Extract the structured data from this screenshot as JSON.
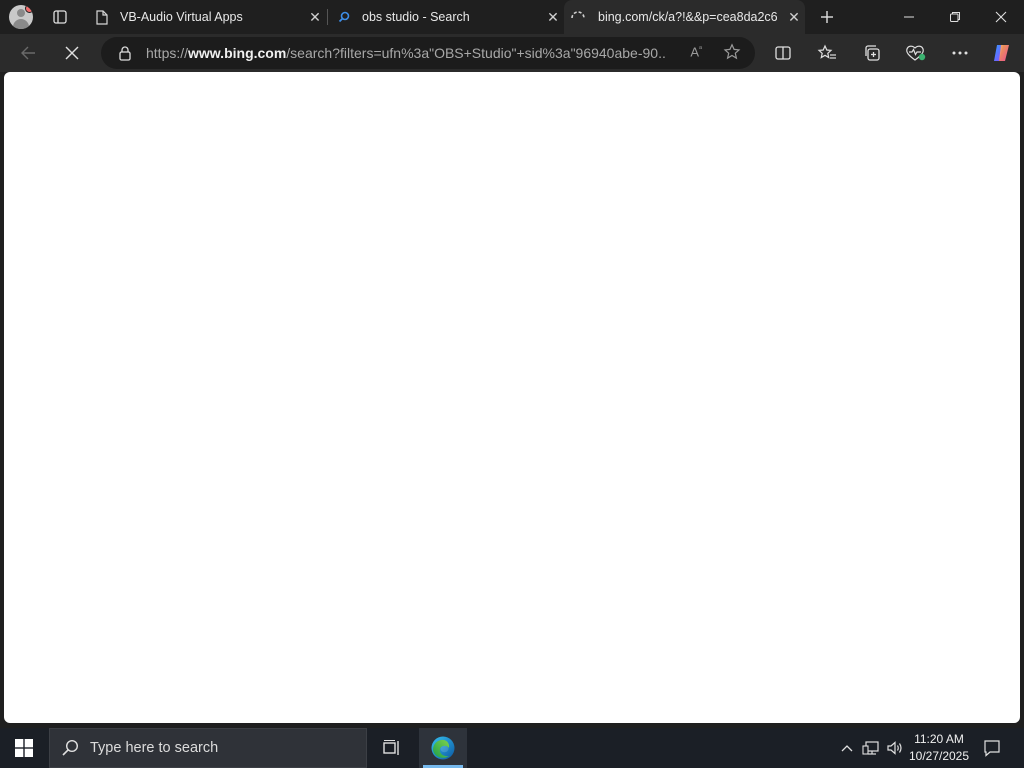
{
  "tabs": [
    {
      "label": "VB-Audio Virtual Apps",
      "icon": "page-icon"
    },
    {
      "label": "obs studio - Search",
      "icon": "search-icon"
    },
    {
      "label": "bing.com/ck/a?!&&p=cea8da2c6",
      "icon": "loading-spinner-icon",
      "active": true
    }
  ],
  "address": {
    "url_prefix": "https://",
    "url_host": "www.bing.com",
    "url_path": "/search?filters=ufn%3a\"OBS+Studio\"+sid%3a\"96940abe-90..."
  },
  "taskbar": {
    "search_placeholder": "Type here to search",
    "time": "11:20 AM",
    "date": "10/27/2025"
  },
  "colors": {
    "chrome_bg": "#1f1f1f",
    "toolbar_bg": "#2b2b2b",
    "taskbar_bg": "#1b1f26",
    "accent": "#76b9ed"
  }
}
